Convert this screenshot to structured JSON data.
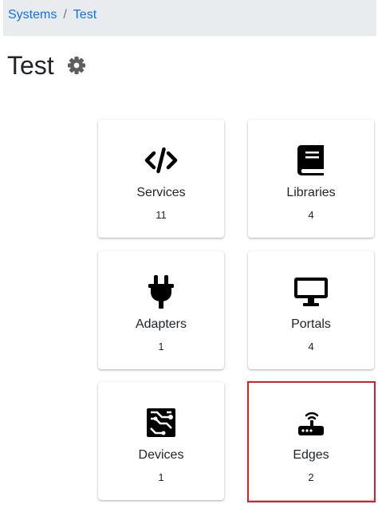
{
  "breadcrumb": {
    "items": [
      {
        "label": "Systems"
      },
      {
        "label": "Test"
      }
    ],
    "separator": "/"
  },
  "page": {
    "title": "Test"
  },
  "cards": [
    {
      "label": "Services",
      "count": "11",
      "icon": "code-icon"
    },
    {
      "label": "Libraries",
      "count": "4",
      "icon": "book-icon"
    },
    {
      "label": "Adapters",
      "count": "1",
      "icon": "plug-icon"
    },
    {
      "label": "Portals",
      "count": "4",
      "icon": "desktop-icon"
    },
    {
      "label": "Devices",
      "count": "1",
      "icon": "circuit-board-icon"
    },
    {
      "label": "Edges",
      "count": "2",
      "icon": "router-icon"
    }
  ],
  "colors": {
    "link": "#0d6efd",
    "breadcrumb_bg": "#e9ecef",
    "highlight": "#d32029"
  }
}
